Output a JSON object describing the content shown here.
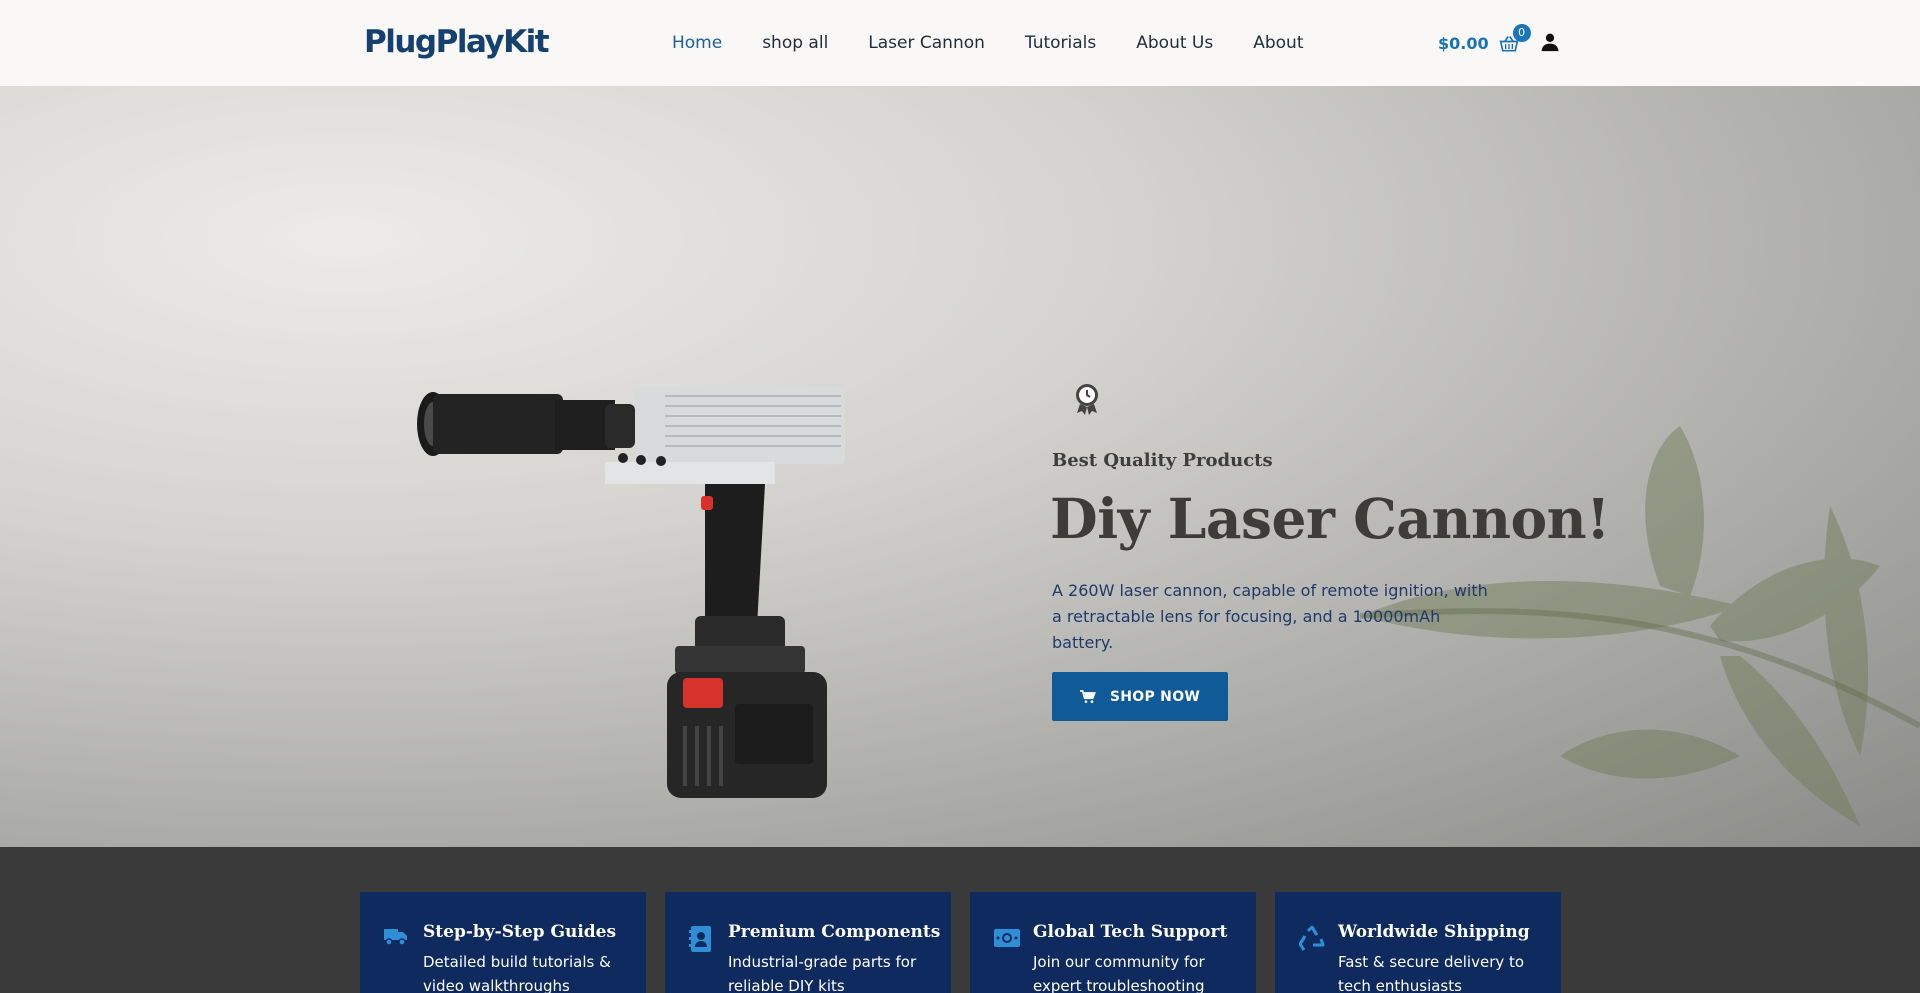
{
  "header": {
    "logo_text_a": "Plug",
    "logo_text_b": "PlayKit",
    "nav": [
      {
        "label": "Home",
        "active": true
      },
      {
        "label": "shop all"
      },
      {
        "label": "Laser Cannon"
      },
      {
        "label": "Tutorials"
      },
      {
        "label": "About Us"
      },
      {
        "label": "About"
      }
    ],
    "cart_total": "$0.00",
    "cart_count": "0",
    "icons": {
      "cart": "basket-icon",
      "user": "user-icon"
    }
  },
  "hero": {
    "eyebrow": "Best Quality Products",
    "title": "Diy Laser Cannon!",
    "description": "A 260W laser cannon, capable of remote ignition, with a retractable lens for focusing, and a 10000mAh battery.",
    "cta_label": "SHOP NOW",
    "icons": {
      "badge": "award-badge-icon",
      "cta": "cart-icon"
    }
  },
  "features": [
    {
      "title": "Step-by-Step Guides",
      "text": "Detailed build tutorials & video walkthroughs",
      "icon": "truck-icon"
    },
    {
      "title": "Premium Components",
      "text": "Industrial-grade parts for reliable DIY kits",
      "icon": "contact-book-icon"
    },
    {
      "title": "Global Tech Support",
      "text": "Join our community for expert troubleshooting",
      "icon": "money-icon"
    },
    {
      "title": "Worldwide Shipping",
      "text": "Fast & secure delivery to tech enthusiasts",
      "icon": "recycle-icon"
    }
  ],
  "colors": {
    "brand": "#15406f",
    "accent": "#0f5a97",
    "card_bg": "#0f2a5e",
    "icon_blue": "#2e8fd6"
  }
}
